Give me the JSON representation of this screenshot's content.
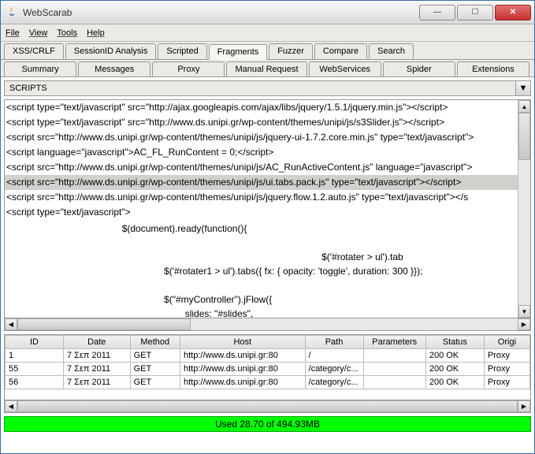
{
  "window": {
    "title": "WebScarab"
  },
  "menubar": [
    "File",
    "View",
    "Tools",
    "Help"
  ],
  "tabs_row1": [
    "XSS/CRLF",
    "SessionID Analysis",
    "Scripted",
    "Fragments",
    "Fuzzer",
    "Compare",
    "Search"
  ],
  "tabs_row1_active": 3,
  "tabs_row2": [
    "Summary",
    "Messages",
    "Proxy",
    "Manual Request",
    "WebServices",
    "Spider",
    "Extensions"
  ],
  "dropdown": {
    "label": "SCRIPTS"
  },
  "script_lines": [
    "<script type=\"text/javascript\" src=\"http://ajax.googleapis.com/ajax/libs/jquery/1.5.1/jquery.min.js\"></script>",
    "<script type=\"text/javascript\" src=\"http://www.ds.unipi.gr/wp-content/themes/unipi/js/s3Slider.js\"></script>",
    "<script src=\"http://www.ds.unipi.gr/wp-content/themes/unipi/js/jquery-ui-1.7.2.core.min.js\" type=\"text/javascript\">",
    "<script language=\"javascript\">AC_FL_RunContent = 0;</script>",
    "<script src=\"http://www.ds.unipi.gr/wp-content/themes/unipi/js/AC_RunActiveContent.js\" language=\"javascript\">",
    "<script src=\"http://www.ds.unipi.gr/wp-content/themes/unipi/js/ui.tabs.pack.js\" type=\"text/javascript\"></script>",
    "<script src=\"http://www.ds.unipi.gr/wp-content/themes/unipi/js/jquery.flow.1.2.auto.js\" type=\"text/javascript\"></s",
    "<script type=\"text/javascript\">"
  ],
  "script_selected_index": 5,
  "script_detail": "                                            $(document).ready(function(){\n\n                                                                                                                        $('#rotater > ul').tab\n                                                            $('#rotater1 > ul').tabs({ fx: { opacity: 'toggle', duration: 300 }});\n\n                                                            $(\"#myController\").jFlow({\n                                                                    slides: \"#slides\",\n                                                                    controller: \".jFlowControl\",\n                                                                    slideWrapper : \"#jFlowSlide\",",
  "table": {
    "columns": [
      "ID",
      "Date",
      "Method",
      "Host",
      "Path",
      "Parameters",
      "Status",
      "Origi"
    ],
    "widths": [
      70,
      80,
      60,
      150,
      70,
      75,
      70,
      55
    ],
    "rows": [
      {
        "id": "1",
        "date": "7 Σεπ 2011",
        "method": "GET",
        "host": "http://www.ds.unipi.gr:80",
        "path": "/",
        "params": "",
        "status": "200 OK",
        "origin": "Proxy"
      },
      {
        "id": "55",
        "date": "7 Σεπ 2011",
        "method": "GET",
        "host": "http://www.ds.unipi.gr:80",
        "path": "/category/c...",
        "params": "",
        "status": "200 OK",
        "origin": "Proxy"
      },
      {
        "id": "56",
        "date": "7 Σεπ 2011",
        "method": "GET",
        "host": "http://www.ds.unipi.gr:80",
        "path": "/category/c...",
        "params": "",
        "status": "200 OK",
        "origin": "Proxy"
      }
    ]
  },
  "status": {
    "text": "Used 28.70 of 494.93MB"
  }
}
